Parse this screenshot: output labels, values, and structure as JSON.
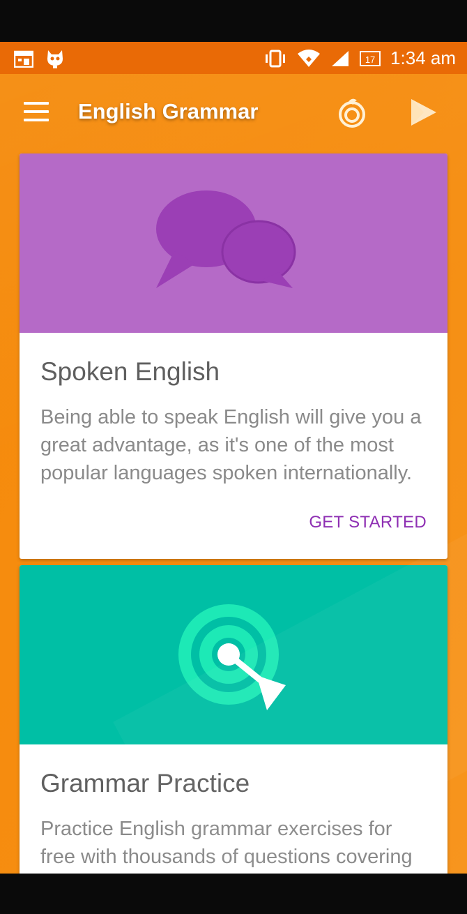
{
  "status_bar": {
    "time": "1:34 am",
    "battery_level": "17",
    "icons": [
      "calendar-icon",
      "cat-icon",
      "vibrate-icon",
      "wifi-icon",
      "signal-icon",
      "battery-icon"
    ]
  },
  "toolbar": {
    "title": "English Grammar",
    "icons": [
      "menu-icon",
      "fire-icon",
      "play-icon"
    ]
  },
  "cards": [
    {
      "title": "Spoken English",
      "description": "Being able to speak English will give you a great advantage, as it's one of the most popular languages spoken internationally.",
      "action": "GET STARTED",
      "icon": "chat-bubbles-icon",
      "color": "#b56ac7"
    },
    {
      "title": "Grammar Practice",
      "description": "Practice English grammar exercises for free with thousands of questions covering",
      "icon": "target-icon",
      "color": "#00bfa5"
    }
  ],
  "colors": {
    "status_bar": "#e96a06",
    "app_background": "#f68d10",
    "accent_purple": "#8e2fb3"
  }
}
